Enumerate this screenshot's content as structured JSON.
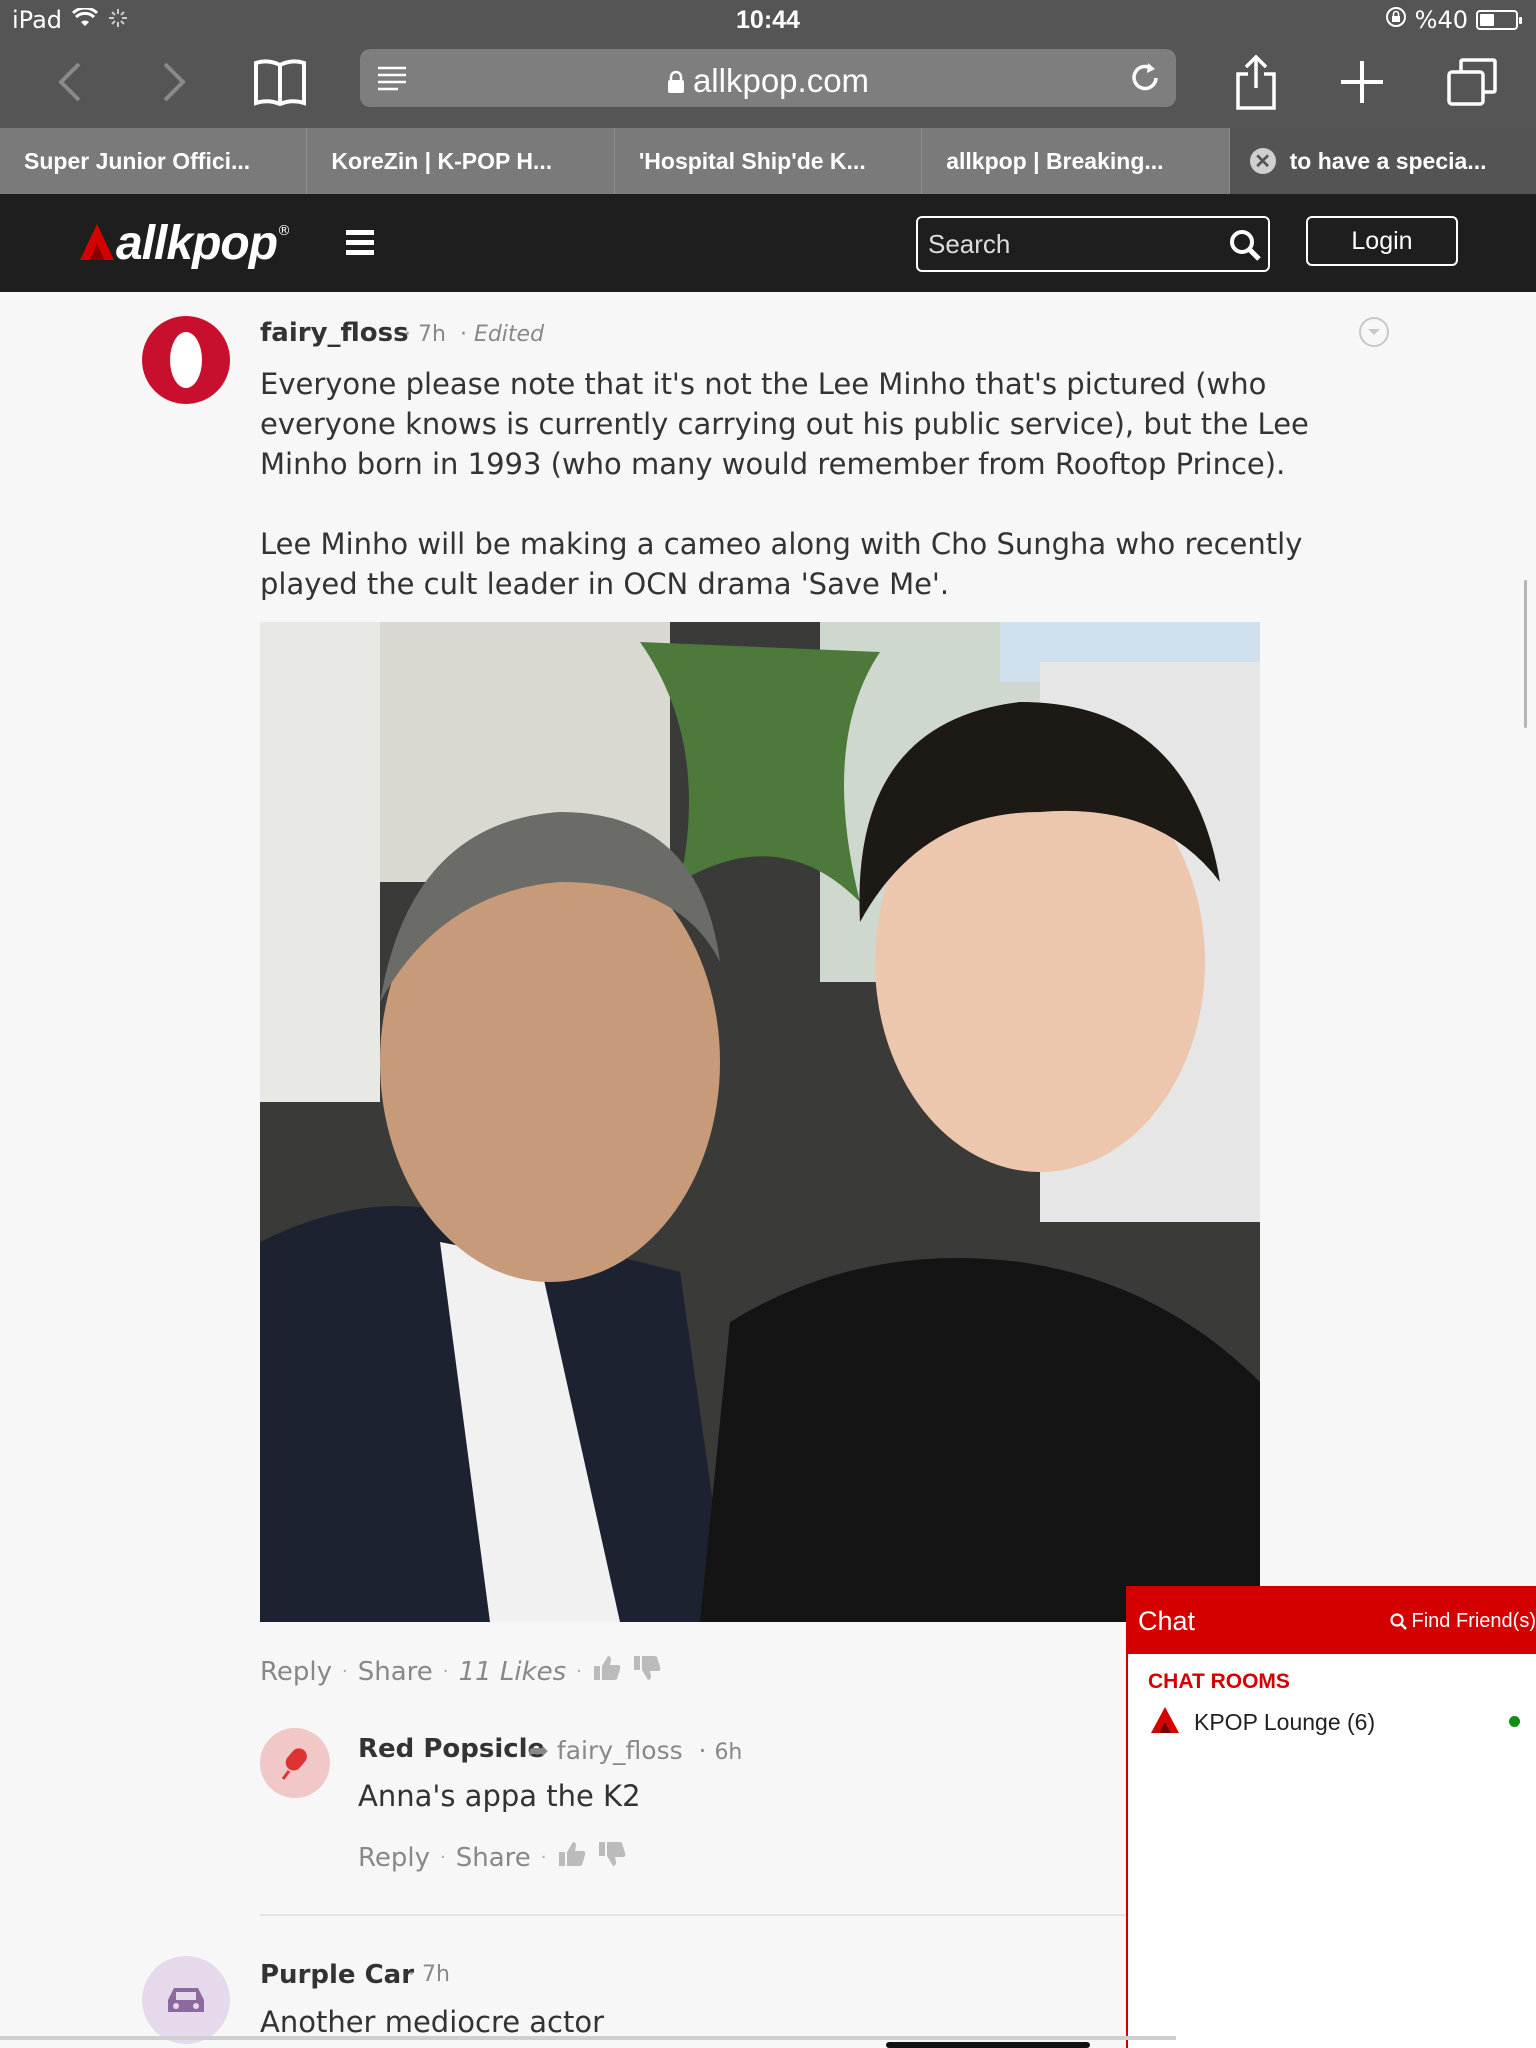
{
  "status_bar": {
    "device": "iPad",
    "time": "10:44",
    "battery": "%40"
  },
  "browser": {
    "url": "allkpop.com",
    "tabs": [
      {
        "label": "Super Junior Offici..."
      },
      {
        "label": "KoreZin | K-POP H..."
      },
      {
        "label": "'Hospital Ship'de K..."
      },
      {
        "label": "allkpop | Breaking..."
      },
      {
        "label": "to have a specia..."
      }
    ]
  },
  "site": {
    "logo": "allkpop",
    "search_placeholder": "Search",
    "login_label": "Login"
  },
  "comments": [
    {
      "user": "fairy_floss",
      "time": "7h",
      "edited": "Edited",
      "paragraph1": "Everyone please note that it's not the Lee Minho that's pictured (who everyone knows is currently carrying out his public service), but the Lee Minho born in 1993 (who many would remember from Rooftop Prince).",
      "paragraph2": "Lee Minho will be making a cameo along with Cho Sungha who recently played the cult leader in OCN drama 'Save Me'.",
      "reply": "Reply",
      "share": "Share",
      "likes": "11 Likes"
    },
    {
      "user": "Red Popsicle",
      "reply_to": "fairy_floss",
      "time": "6h",
      "text": "Anna's appa the K2",
      "reply": "Reply",
      "share": "Share"
    },
    {
      "user": "Purple Car",
      "time": "7h",
      "text": "Another mediocre actor"
    }
  ],
  "chat": {
    "title": "Chat",
    "find": "Find Friend(s)",
    "rooms_label": "CHAT ROOMS",
    "room": "KPOP Lounge (6)"
  },
  "colors": {
    "brand_red": "#d40000",
    "header_bg": "#1e1e1e",
    "browser_chrome": "#555555"
  }
}
